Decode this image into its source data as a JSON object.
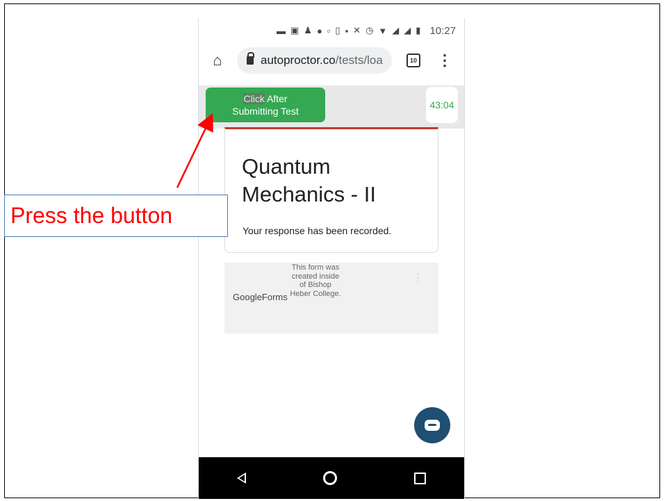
{
  "status_bar": {
    "time": "10:27"
  },
  "browser": {
    "url_domain": "autoproctor.co",
    "url_path": "/tests/loa",
    "tab_count": "10"
  },
  "toolbar": {
    "submit_button_word_highlighted": "Click",
    "submit_button_line1_rest": " After",
    "submit_button_line2": "Submitting Test",
    "timer": "43:04"
  },
  "form": {
    "title": "Quantum Mechanics - II",
    "message": "Your response has been recorded."
  },
  "footer": {
    "logo_google": "Google",
    "logo_forms": "Forms",
    "note": "This form was created inside of Bishop Heber College."
  },
  "annotation": {
    "label": "Press the button",
    "color": "#ff0000"
  },
  "colors": {
    "submit_green": "#34a853",
    "card_accent": "#c0392b",
    "fab": "#1f4f73"
  }
}
